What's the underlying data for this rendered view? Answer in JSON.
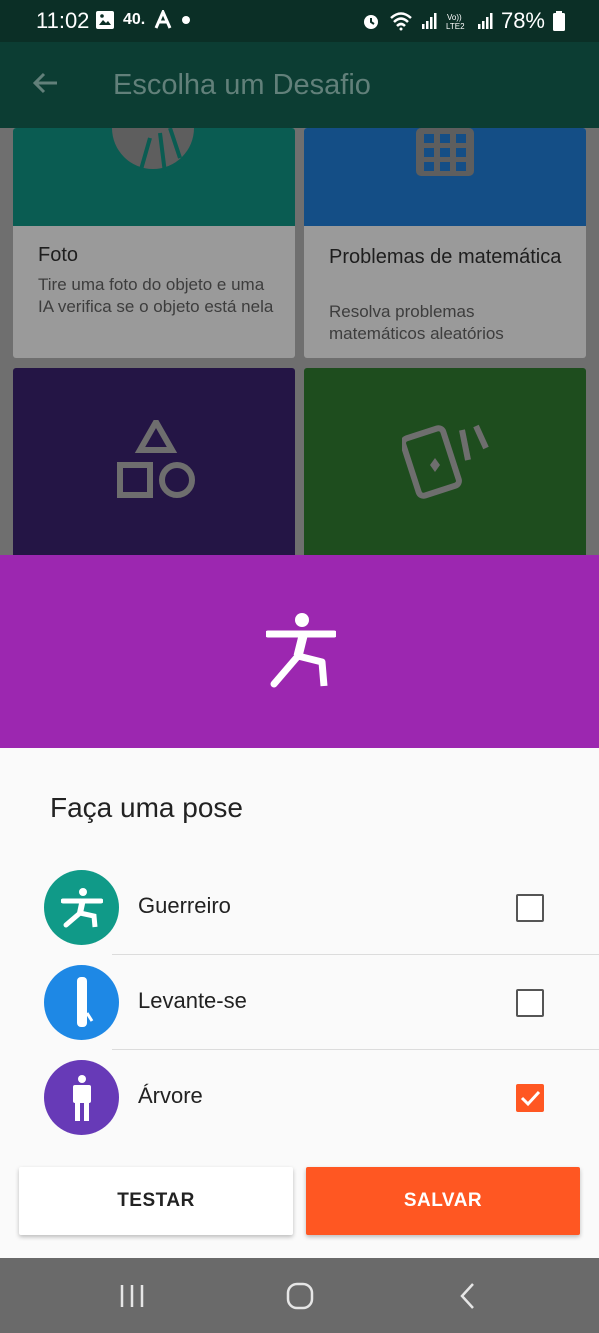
{
  "status_bar": {
    "time": "11:02",
    "left_indicators": "40.",
    "battery": "78%"
  },
  "app_bar": {
    "title": "Escolha um Desafio"
  },
  "challenges": [
    {
      "title": "Foto",
      "description": "Tire uma foto do objeto e uma IA verifica se o objeto está nela"
    },
    {
      "title": "Problemas de matemática",
      "description": "Resolva problemas matemáticos aleatórios"
    }
  ],
  "sheet": {
    "title": "Faça uma pose",
    "poses": [
      {
        "label": "Guerreiro",
        "color": "#109a88",
        "checked": false,
        "icon": "warrior-pose-icon"
      },
      {
        "label": "Levante-se",
        "color": "#1e88e5",
        "checked": false,
        "icon": "stand-up-icon"
      },
      {
        "label": "Árvore",
        "color": "#673ab7",
        "checked": true,
        "icon": "tree-pose-icon"
      }
    ],
    "test_label": "TESTAR",
    "save_label": "SALVAR"
  },
  "colors": {
    "sheet_header": "#9c27b0",
    "accent": "#ff5722"
  }
}
